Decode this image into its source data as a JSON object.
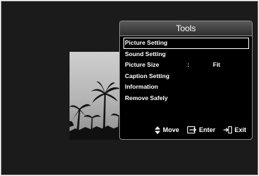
{
  "panel": {
    "title": "Tools"
  },
  "menu": {
    "items": [
      {
        "label": "Picture Setting",
        "selected": true
      },
      {
        "label": "Sound Setting"
      },
      {
        "label": "Picture Size",
        "separator": ":",
        "value": "Fit"
      },
      {
        "label": "Caption Setting"
      },
      {
        "label": "Information"
      },
      {
        "label": "Remove Safely"
      }
    ]
  },
  "footer": {
    "move_label": "Move",
    "enter_label": "Enter",
    "exit_label": "Exit",
    "move_icon": "up-down-arrow-icon",
    "enter_icon": "enter-icon",
    "exit_icon": "exit-icon"
  },
  "colors": {
    "screen_bg": "#1b1b1b",
    "panel_bg": "#000000",
    "text": "#ffffff"
  }
}
